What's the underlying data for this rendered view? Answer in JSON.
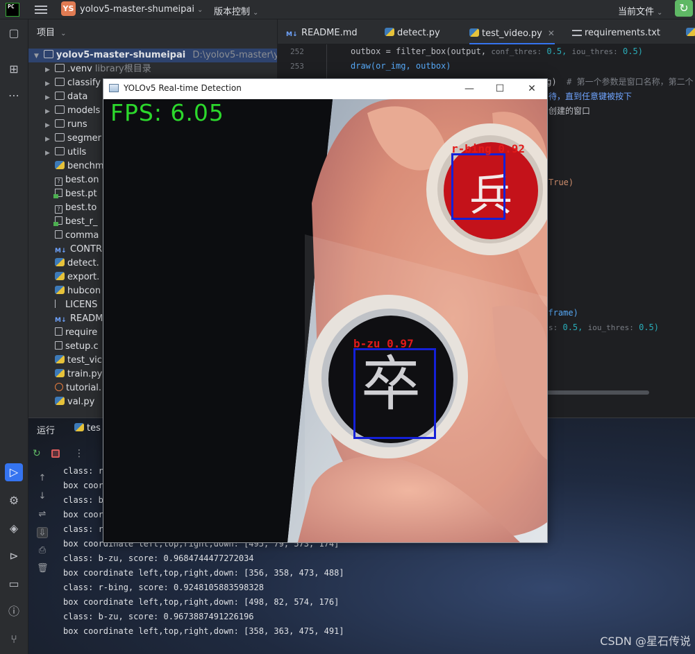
{
  "titlebar": {
    "logo_text": "PC",
    "project_badge": "YS",
    "project_name": "yolov5-master-shumeipai",
    "vcs": "版本控制",
    "current_file": "当前文件"
  },
  "project_panel": {
    "title": "项目",
    "root_name": "yolov5-master-shumeipai",
    "root_path": "D:\\yolov5-master\\yolov5",
    "items": [
      {
        "name": ".venv",
        "note": "library根目录",
        "kind": "folder"
      },
      {
        "name": "classify",
        "kind": "folder"
      },
      {
        "name": "data",
        "kind": "folder"
      },
      {
        "name": "models",
        "kind": "folder"
      },
      {
        "name": "runs",
        "kind": "folder"
      },
      {
        "name": "segmer",
        "kind": "folder"
      },
      {
        "name": "utils",
        "kind": "folder"
      },
      {
        "name": "benchm",
        "kind": "py"
      },
      {
        "name": "best.on",
        "kind": "q"
      },
      {
        "name": "best.pt",
        "kind": "pt"
      },
      {
        "name": "best.to",
        "kind": "q"
      },
      {
        "name": "best_r_",
        "kind": "pt"
      },
      {
        "name": "comma",
        "kind": "file"
      },
      {
        "name": "CONTR",
        "kind": "md"
      },
      {
        "name": "detect.",
        "kind": "py"
      },
      {
        "name": "export.",
        "kind": "py"
      },
      {
        "name": "hubcon",
        "kind": "py"
      },
      {
        "name": "LICENS",
        "kind": "lic"
      },
      {
        "name": "READM",
        "kind": "md"
      },
      {
        "name": "require",
        "kind": "file"
      },
      {
        "name": "setup.c",
        "kind": "file"
      },
      {
        "name": "test_vic",
        "kind": "py"
      },
      {
        "name": "train.py",
        "kind": "py"
      },
      {
        "name": "tutorial.",
        "kind": "jn"
      },
      {
        "name": "val.py",
        "kind": "py"
      }
    ]
  },
  "editor": {
    "tabs": [
      {
        "label": "README.md",
        "icon": "markdown-icon"
      },
      {
        "label": "detect.py",
        "icon": "python-icon"
      },
      {
        "label": "test_video.py",
        "icon": "python-icon",
        "active": true
      },
      {
        "label": "requirements.txt",
        "icon": "text-file-icon"
      }
    ],
    "line_numbers": [
      "252",
      "253"
    ],
    "line1": {
      "code": "outbox = filter_box(output,",
      "hint1": "conf_thres:",
      "val1": "0.5,",
      "hint2": "iou_thres:",
      "val2": "0.5)"
    },
    "line2": {
      "code": "draw(or_img, outbox)"
    },
    "line3": {
      "code": "mg)",
      "comment": "# 第一个参数是窗口名称，第二个"
    },
    "line4": {
      "comment": "待，直到任意键被按下"
    },
    "line5": {
      "comment": "创建的窗口"
    },
    "line6": {
      "code": "True)"
    },
    "line7": {
      "code": "e(frame)"
    },
    "line8": {
      "hint1": "s:",
      "val1": "0.5,",
      "hint2": "iou_thres:",
      "val2": "0.5)"
    }
  },
  "run_panel": {
    "title": "运行",
    "tab": "tes"
  },
  "console": {
    "lines": [
      "class: r",
      "box coor",
      "class: b",
      "box coor",
      "class: r",
      "box coordinate left,top,right,down: [495, 79, 573, 174]",
      "class: b-zu, score: 0.9684744477272034",
      "box coordinate left,top,right,down: [356, 358, 473, 488]",
      "class: r-bing, score: 0.9248105883598328",
      "box coordinate left,top,right,down: [498, 82, 574, 176]",
      "class: b-zu, score: 0.9673887491226196",
      "box coordinate left,top,right,down: [358, 363, 475, 491]"
    ]
  },
  "cv_window": {
    "title": "YOLOv5 Real-time Detection",
    "fps_text": "FPS: 6.05",
    "detections": [
      {
        "label": "r-bing 0.92",
        "character": "兵",
        "piece_color": "red"
      },
      {
        "label": "b-zu 0.97",
        "character": "卒",
        "piece_color": "black"
      }
    ]
  },
  "watermark": "CSDN @星石传说",
  "colors": {
    "accent": "#3574f0",
    "fps_green": "#2cd82c",
    "box_blue": "#1420d8",
    "label_red": "#e21a1a"
  }
}
